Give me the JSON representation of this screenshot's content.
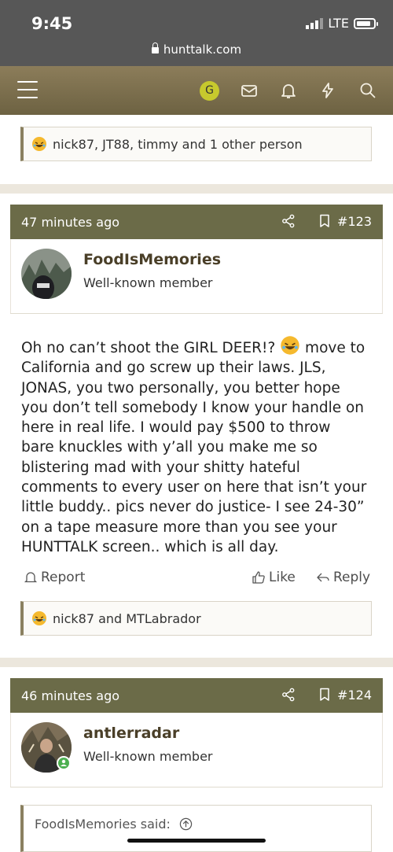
{
  "status_bar": {
    "time": "9:45",
    "network": "LTE",
    "url": "hunttalk.com"
  },
  "nav": {
    "avatar_letter": "G",
    "icons": [
      "menu-icon",
      "envelope-icon",
      "bell-icon",
      "lightning-icon",
      "search-icon"
    ]
  },
  "top_reactions": {
    "text": "nick87, JT88, timmy and 1 other person"
  },
  "posts": [
    {
      "time": "47 minutes ago",
      "number": "#123",
      "username": "FoodIsMemories",
      "role": "Well-known member",
      "body_part1": "Oh no can’t shoot the GIRL DEER!?",
      "body_part2": "move to California and go screw up their laws. JLS, JONAS, you two personally, you better hope you don’t tell somebody I know your handle on here in real life. I would pay $500 to throw bare knuckles with y’all you make me so blistering mad with your shitty hateful comments to every user on here that isn’t your little buddy.. pics never do justice- I see 24-30” on a tape measure more than you see your HUNTTALK screen.. which is all day.",
      "actions": {
        "report": "Report",
        "like": "Like",
        "reply": "Reply"
      },
      "reactions": "nick87 and MTLabrador"
    },
    {
      "time": "46 minutes ago",
      "number": "#124",
      "username": "antlerradar",
      "role": "Well-known member",
      "quote_author": "FoodIsMemories said:"
    }
  ],
  "colors": {
    "nav_bg": "#7c6f4e",
    "post_header": "#6b6b48",
    "username": "#4a3f28",
    "online": "#4caf50"
  }
}
